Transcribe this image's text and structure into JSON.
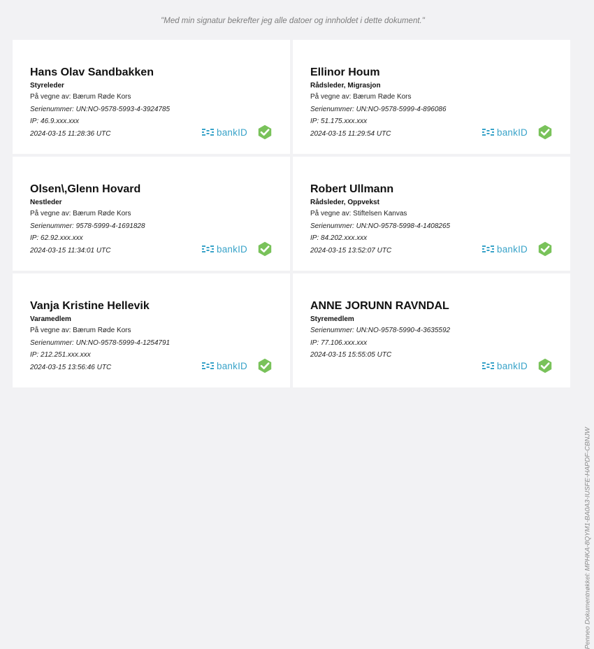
{
  "statement": "\"Med min signatur bekrefter jeg alle datoer og innholdet i dette dokument.\"",
  "document_key": "Penneo Dokumentnøkkel: MPHKA-8QYM1-BA0A3-IUSFE-HAPDF-CBNJW",
  "brand": {
    "bankid_text": "bankID",
    "accent": "#39a3c9",
    "check_color": "#79c25a"
  },
  "signers": [
    {
      "name": "Hans Olav Sandbakken",
      "role": "Styreleder",
      "on_behalf": "På vegne av: Bærum Røde Kors",
      "serial": "Serienummer: UN:NO-9578-5993-4-3924785",
      "ip": "IP: 46.9.xxx.xxx",
      "timestamp": "2024-03-15 11:28:36 UTC"
    },
    {
      "name": "Ellinor Houm",
      "role": "Rådsleder, Migrasjon",
      "on_behalf": "På vegne av: Bærum Røde Kors",
      "serial": "Serienummer: UN:NO-9578-5999-4-896086",
      "ip": "IP: 51.175.xxx.xxx",
      "timestamp": "2024-03-15 11:29:54 UTC"
    },
    {
      "name": "Olsen\\,Glenn Hovard",
      "role": "Nestleder",
      "on_behalf": "På vegne av: Bærum Røde Kors",
      "serial": "Serienummer: 9578-5999-4-1691828",
      "ip": "IP: 62.92.xxx.xxx",
      "timestamp": "2024-03-15 11:34:01 UTC"
    },
    {
      "name": "Robert Ullmann",
      "role": "Rådsleder, Oppvekst",
      "on_behalf": "På vegne av: Stiftelsen Kanvas",
      "serial": "Serienummer: UN:NO-9578-5998-4-1408265",
      "ip": "IP: 84.202.xxx.xxx",
      "timestamp": "2024-03-15 13:52:07 UTC"
    },
    {
      "name": "Vanja Kristine Hellevik",
      "role": "Varamedlem",
      "on_behalf": "På vegne av: Bærum Røde Kors",
      "serial": "Serienummer: UN:NO-9578-5999-4-1254791",
      "ip": "IP: 212.251.xxx.xxx",
      "timestamp": "2024-03-15 13:56:46 UTC"
    },
    {
      "name": "ANNE JORUNN RAVNDAL",
      "role": "Styremedlem",
      "serial": "Serienummer: UN:NO-9578-5990-4-3635592",
      "ip": "IP: 77.106.xxx.xxx",
      "timestamp": "2024-03-15 15:55:05 UTC"
    }
  ]
}
